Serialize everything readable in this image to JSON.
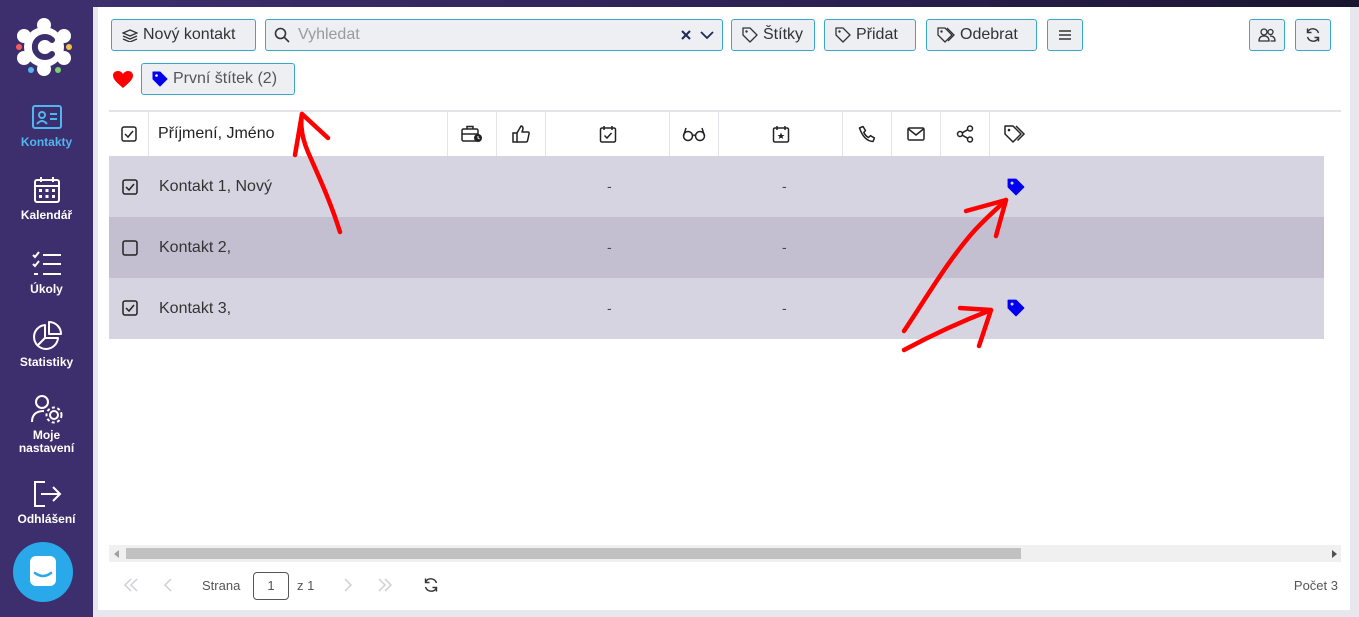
{
  "toolbar": {
    "new_contact_label": "Nový kontakt",
    "search_placeholder": "Vyhledat",
    "tags_label": "Štítky",
    "add_label": "Přidat",
    "remove_label": "Odebrat"
  },
  "filter": {
    "tag_chip_label": "První štítek (2)"
  },
  "sidebar": {
    "items": [
      {
        "label": "Kontakty",
        "icon": "contact-card-icon"
      },
      {
        "label": "Kalendář",
        "icon": "calendar-icon"
      },
      {
        "label": "Úkoly",
        "icon": "task-list-icon"
      },
      {
        "label": "Statistiky",
        "icon": "pie-chart-icon"
      },
      {
        "label_line1": "Moje",
        "label_line2": "nastavení",
        "icon": "user-settings-icon"
      },
      {
        "label": "Odhlášení",
        "icon": "logout-icon"
      }
    ]
  },
  "table": {
    "name_header": "Příjmení, Jméno",
    "rows": [
      {
        "name": "Kontakt 1, Nový",
        "checked": true,
        "col_a": "-",
        "col_b": "-",
        "tag": true
      },
      {
        "name": "Kontakt 2,",
        "checked": false,
        "col_a": "-",
        "col_b": "-",
        "tag": false
      },
      {
        "name": "Kontakt 3,",
        "checked": true,
        "col_a": "-",
        "col_b": "-",
        "tag": true
      }
    ]
  },
  "pager": {
    "page_label": "Strana",
    "page_value": "1",
    "of_label": "z 1",
    "count_label": "Počet 3"
  },
  "colors": {
    "sidebar": "#3d2f6d",
    "accent": "#39a8c6",
    "active_nav": "#4fb6ef",
    "tag_blue": "#0000ee",
    "annotation_red": "#ff0000",
    "row_odd": "#d7d4e1",
    "row_even": "#c3bfd1"
  }
}
